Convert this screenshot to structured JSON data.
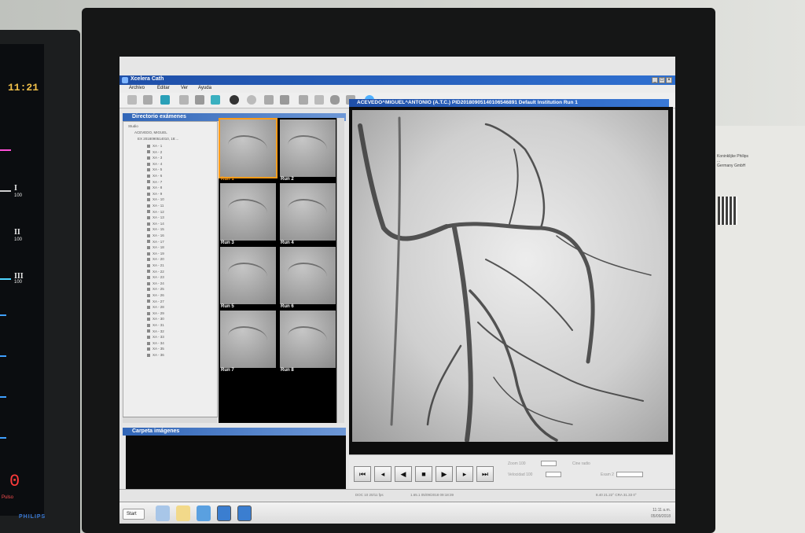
{
  "vitals": {
    "time": "11:21",
    "leads": [
      {
        "label": "I",
        "sub": "100"
      },
      {
        "label": "II",
        "sub": "100"
      },
      {
        "label": "III",
        "sub": "100"
      }
    ],
    "pulse_value": "0",
    "pulse_label": "Pulso",
    "brand": "PHILIPS"
  },
  "app": {
    "title": "Xcelera Cath",
    "menus": [
      "Archivo",
      "Editar",
      "Ver",
      "Ayuda"
    ],
    "panels": {
      "directory_title": "Directorio exámenes",
      "images_title": "Carpeta imágenes"
    },
    "tree": {
      "root": "Studio",
      "patient": "ACEVEDO, MIGUEL",
      "study": "EX 2018090514010, 18:...",
      "series": [
        "XA - 1",
        "XA - 2",
        "XA - 3",
        "XA - 4",
        "XA - 5",
        "XA - 6",
        "XA - 7",
        "XA - 8",
        "XA - 9",
        "XA - 10",
        "XA - 11",
        "XA - 12",
        "XA - 13",
        "XA - 14",
        "XA - 15",
        "XA - 16",
        "XA - 17",
        "XA - 18",
        "XA - 19",
        "XA - 20",
        "XA - 21",
        "XA - 22",
        "XA - 23",
        "XA - 24",
        "XA - 25",
        "XA - 26",
        "XA - 27",
        "XA - 28",
        "XA - 29",
        "XA - 30",
        "XA - 31",
        "XA - 32",
        "XA - 33",
        "XA - 34",
        "XA - 35",
        "XA - 36"
      ]
    },
    "runs": [
      "Run 1",
      "Run 2",
      "Run 3",
      "Run 4",
      "Run 5",
      "Run 6",
      "Run 7",
      "Run 8"
    ],
    "viewer_title": "ACEVEDO^MIGUEL^ANTONIO (A.T.C.) PID20180905140106546891  Default Institution Run 1",
    "controls": {
      "zoom_label": "Zoom 100",
      "speed_label": "Velocidad 100",
      "cine_label": "Cine radio",
      "frame_label": "Exam 2"
    },
    "status": {
      "left": "DOC 10   20/11 fps",
      "mid": "1.65.1      05/09/2018 09:18:39",
      "right": "8.40 21.22°  CRA 31.33 0°"
    },
    "taskbar": {
      "start": "Start",
      "clock": "11:11 a.m.",
      "date": "05/09/2018"
    }
  },
  "ul_label": [
    "Koninklijke Philips",
    "...",
    "Germany GmbH"
  ],
  "colors": {
    "titlebar": "#1f4fa8",
    "panel_header": "#3166b8",
    "selected_run": "#ff9c1a",
    "vitals_time": "#f2c14a",
    "pulse_value": "#ff3b3b"
  }
}
